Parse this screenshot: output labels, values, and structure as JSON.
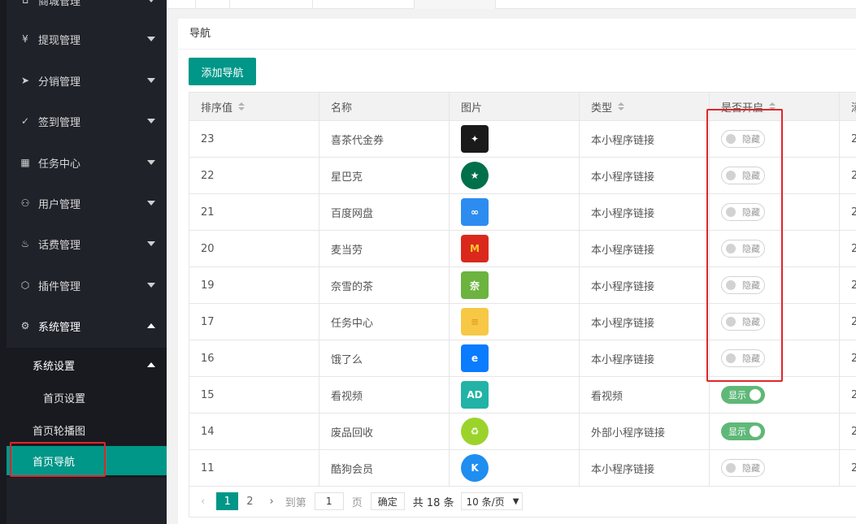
{
  "sidebar": {
    "items": [
      {
        "label": "商城管理",
        "icon": "shop-icon",
        "glyph": "⌂"
      },
      {
        "label": "提现管理",
        "icon": "yen-icon",
        "glyph": "¥"
      },
      {
        "label": "分销管理",
        "icon": "send-icon",
        "glyph": "➤"
      },
      {
        "label": "签到管理",
        "icon": "check-icon",
        "glyph": "✓"
      },
      {
        "label": "任务中心",
        "icon": "grid-icon",
        "glyph": "▦"
      },
      {
        "label": "用户管理",
        "icon": "user-icon",
        "glyph": "⚇"
      },
      {
        "label": "话费管理",
        "icon": "fire-icon",
        "glyph": "♨"
      },
      {
        "label": "插件管理",
        "icon": "cube-icon",
        "glyph": "⬡"
      },
      {
        "label": "系统管理",
        "icon": "gear-icon",
        "glyph": "⚙"
      }
    ],
    "sub": {
      "group": "系统设置",
      "home_settings": "首页设置",
      "banner": "首页轮播图",
      "nav": "首页导航"
    }
  },
  "card": {
    "title": "导航",
    "add_button": "添加导航"
  },
  "table": {
    "headers": [
      "排序值",
      "名称",
      "图片",
      "类型",
      "是否开启",
      "添"
    ],
    "rows": [
      {
        "sort": "23",
        "name": "喜茶代金券",
        "img": "heytea-logo",
        "type": "本小程序链接",
        "status": "隐藏",
        "on": false,
        "extra": "2"
      },
      {
        "sort": "22",
        "name": "星巴克",
        "img": "starbucks-logo",
        "type": "本小程序链接",
        "status": "隐藏",
        "on": false,
        "extra": "2"
      },
      {
        "sort": "21",
        "name": "百度网盘",
        "img": "baidu-netdisk-logo",
        "type": "本小程序链接",
        "status": "隐藏",
        "on": false,
        "extra": "2"
      },
      {
        "sort": "20",
        "name": "麦当劳",
        "img": "mcdonalds-logo",
        "type": "本小程序链接",
        "status": "隐藏",
        "on": false,
        "extra": "2"
      },
      {
        "sort": "19",
        "name": "奈雪的茶",
        "img": "nayuki-logo",
        "type": "本小程序链接",
        "status": "隐藏",
        "on": false,
        "extra": "2"
      },
      {
        "sort": "17",
        "name": "任务中心",
        "img": "task-center-icon",
        "type": "本小程序链接",
        "status": "隐藏",
        "on": false,
        "extra": "2"
      },
      {
        "sort": "16",
        "name": "饿了么",
        "img": "eleme-logo",
        "type": "本小程序链接",
        "status": "隐藏",
        "on": false,
        "extra": "2"
      },
      {
        "sort": "15",
        "name": "看视频",
        "img": "ad-video-icon",
        "type": "看视频",
        "status": "显示",
        "on": true,
        "extra": "2"
      },
      {
        "sort": "14",
        "name": "废品回收",
        "img": "recycle-icon",
        "type": "外部小程序链接",
        "status": "显示",
        "on": true,
        "extra": "2"
      },
      {
        "sort": "11",
        "name": "酷狗会员",
        "img": "kugou-logo",
        "type": "本小程序链接",
        "status": "隐藏",
        "on": false,
        "extra": "2"
      }
    ]
  },
  "pager": {
    "current": "1",
    "next_page": "2",
    "goto_label": "到第",
    "goto_value": "1",
    "page_unit": "页",
    "confirm": "确定",
    "total": "共 18 条",
    "per_page": "10 条/页"
  },
  "colors": {
    "accent": "#009688",
    "switch_on": "#5fb878",
    "highlight": "#e0262b",
    "sidebar_bg": "#20222a"
  }
}
